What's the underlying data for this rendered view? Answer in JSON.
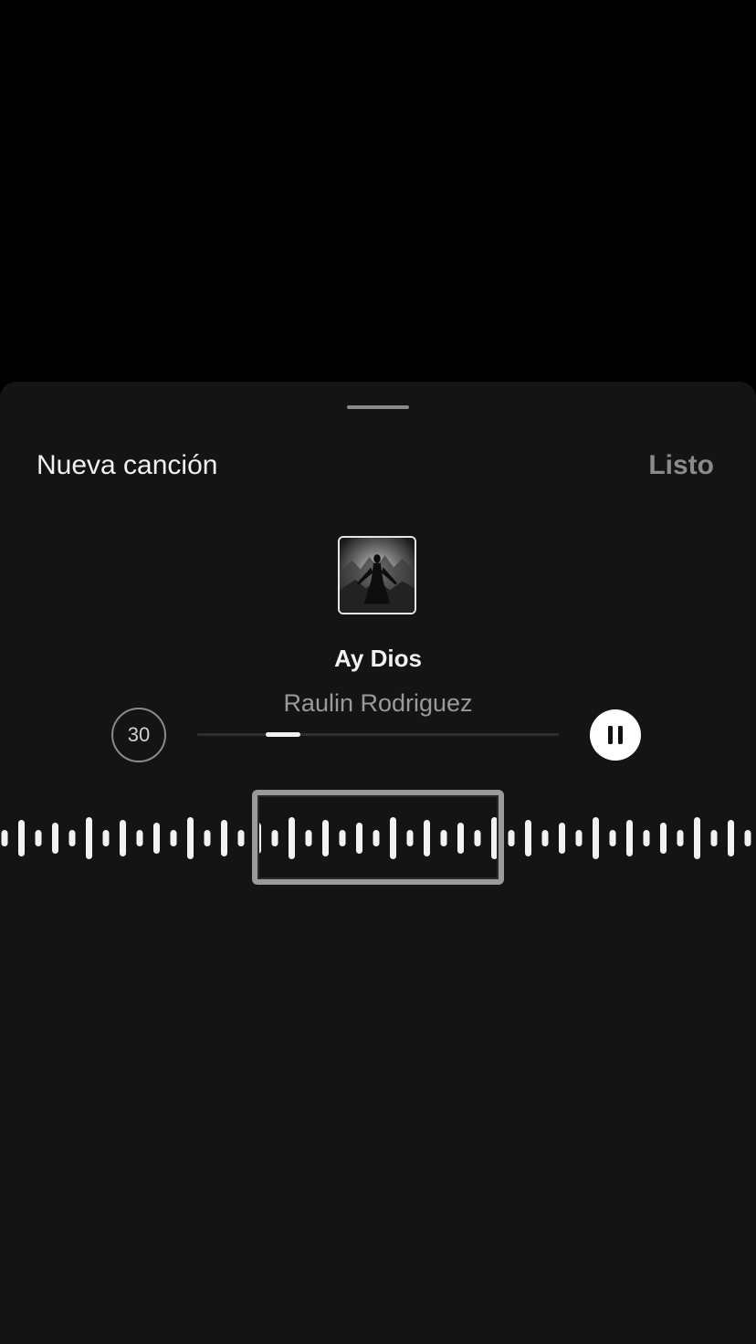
{
  "sheet": {
    "title": "Nueva canción",
    "done_label": "Listo"
  },
  "song": {
    "title": "Ay Dios",
    "artist": "Raulin Rodriguez"
  },
  "player": {
    "clip_duration_seconds": "30",
    "progress_fraction": 0.18,
    "state": "playing",
    "control_icon": "pause-icon"
  },
  "waveform": {
    "selection_start_fraction": 0.335,
    "selection_end_fraction": 0.665
  },
  "colors": {
    "background": "#000000",
    "sheet": "#141414",
    "primary_text": "#f2f2f2",
    "secondary_text": "#9a9a9a",
    "accent": "#ffffff"
  }
}
